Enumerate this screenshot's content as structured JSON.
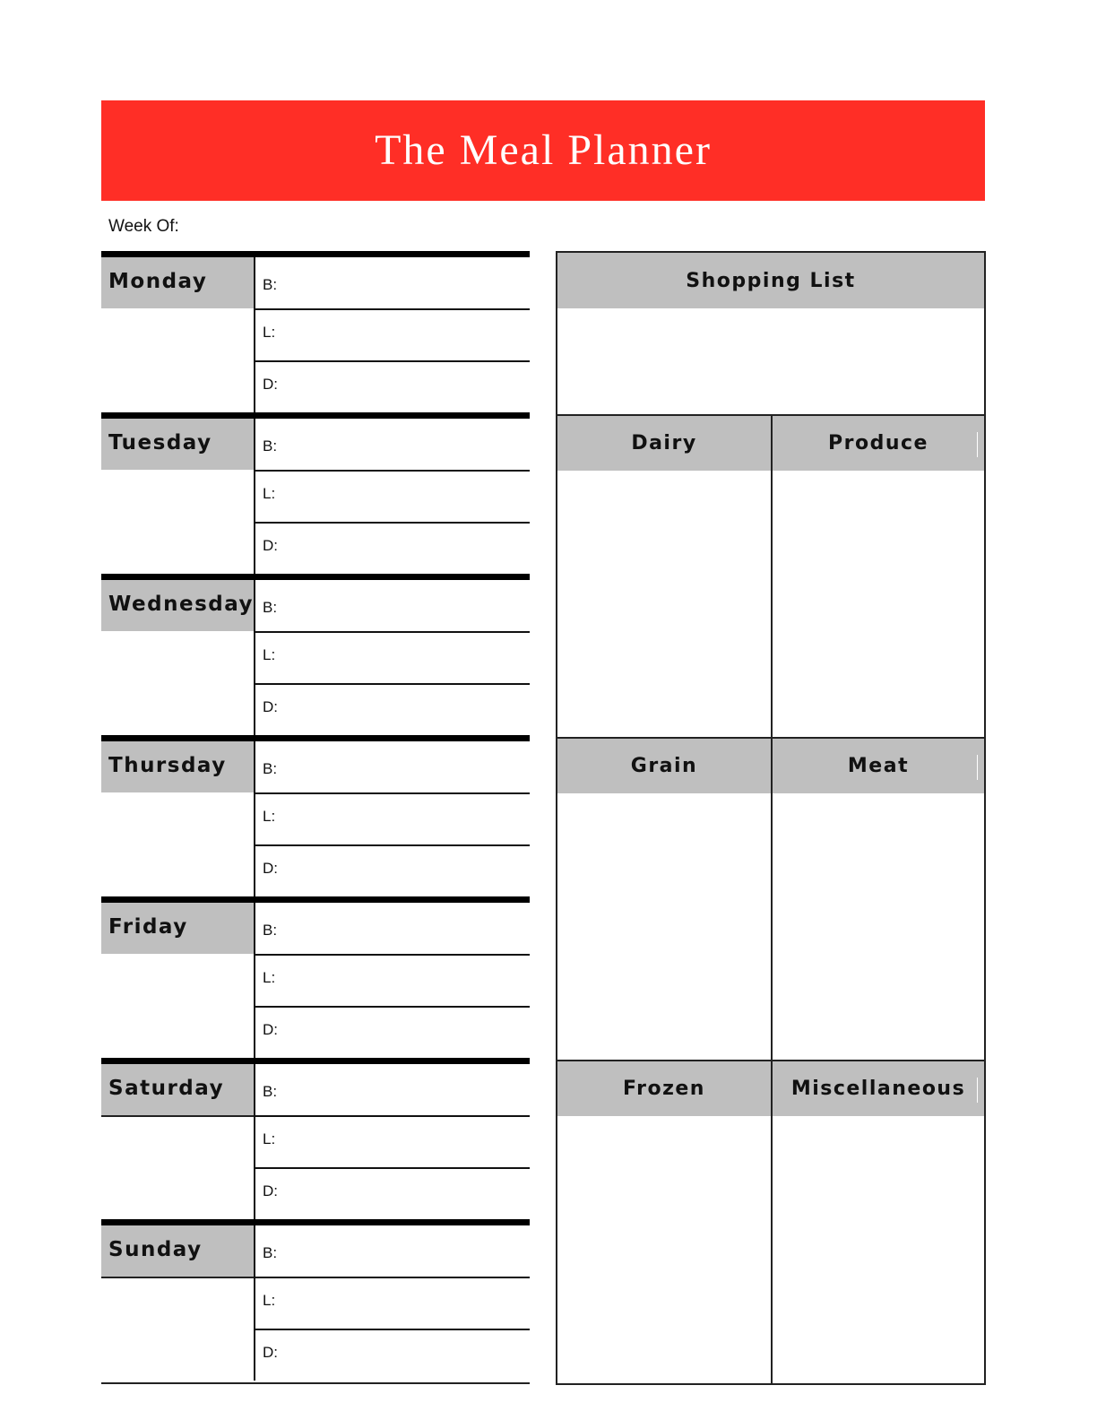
{
  "header": {
    "title": "The Meal Planner",
    "accent_color": "#ff2e26"
  },
  "week_of": {
    "label": "Week Of:",
    "value": ""
  },
  "days": [
    {
      "name": "Monday",
      "meals": [
        {
          "label": "B:",
          "value": ""
        },
        {
          "label": "L:",
          "value": ""
        },
        {
          "label": "D:",
          "value": ""
        }
      ]
    },
    {
      "name": "Tuesday",
      "meals": [
        {
          "label": "B:",
          "value": ""
        },
        {
          "label": "L:",
          "value": ""
        },
        {
          "label": "D:",
          "value": ""
        }
      ]
    },
    {
      "name": "Wednesday",
      "meals": [
        {
          "label": "B:",
          "value": ""
        },
        {
          "label": "L:",
          "value": ""
        },
        {
          "label": "D:",
          "value": ""
        }
      ]
    },
    {
      "name": "Thursday",
      "meals": [
        {
          "label": "B:",
          "value": ""
        },
        {
          "label": "L:",
          "value": ""
        },
        {
          "label": "D:",
          "value": ""
        }
      ]
    },
    {
      "name": "Friday",
      "meals": [
        {
          "label": "B:",
          "value": ""
        },
        {
          "label": "L:",
          "value": ""
        },
        {
          "label": "D:",
          "value": ""
        }
      ]
    },
    {
      "name": "Saturday",
      "meals": [
        {
          "label": "B:",
          "value": ""
        },
        {
          "label": "L:",
          "value": ""
        },
        {
          "label": "D:",
          "value": ""
        }
      ]
    },
    {
      "name": "Sunday",
      "meals": [
        {
          "label": "B:",
          "value": ""
        },
        {
          "label": "L:",
          "value": ""
        },
        {
          "label": "D:",
          "value": ""
        }
      ]
    }
  ],
  "shopping_list": {
    "title": "Shopping List",
    "notes": "",
    "categories": [
      {
        "name": "Dairy",
        "items": []
      },
      {
        "name": "Produce",
        "items": []
      },
      {
        "name": "Grain",
        "items": []
      },
      {
        "name": "Meat",
        "items": []
      },
      {
        "name": "Frozen",
        "items": []
      },
      {
        "name": "Miscellaneous",
        "items": []
      }
    ]
  },
  "colors": {
    "header_gray": "#bfbfbf",
    "rule": "#000000"
  }
}
